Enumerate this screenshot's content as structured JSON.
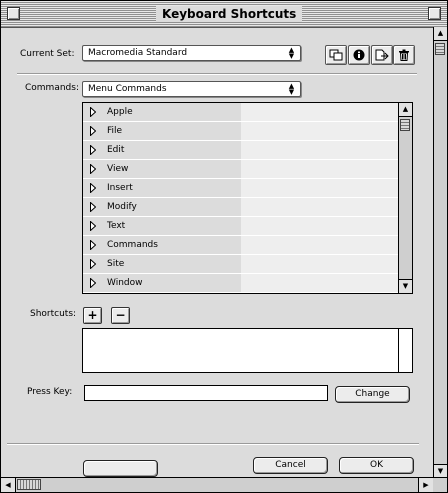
{
  "window": {
    "title": "Keyboard Shortcuts"
  },
  "current_set": {
    "label": "Current Set:",
    "value": "Macromedia Standard"
  },
  "set_buttons": [
    {
      "icon": "duplicate-set-icon"
    },
    {
      "icon": "info-icon"
    },
    {
      "icon": "export-set-icon"
    },
    {
      "icon": "trash-icon"
    }
  ],
  "commands": {
    "label": "Commands:",
    "value": "Menu Commands",
    "items": [
      {
        "name": "Apple"
      },
      {
        "name": "File"
      },
      {
        "name": "Edit"
      },
      {
        "name": "View"
      },
      {
        "name": "Insert"
      },
      {
        "name": "Modify"
      },
      {
        "name": "Text"
      },
      {
        "name": "Commands"
      },
      {
        "name": "Site"
      },
      {
        "name": "Window"
      }
    ]
  },
  "shortcuts": {
    "label": "Shortcuts:",
    "add": "+",
    "remove": "−"
  },
  "press_key": {
    "label": "Press Key:",
    "value": "",
    "change_label": "Change"
  },
  "footer": {
    "cancel_label": "Cancel",
    "ok_label": "OK"
  }
}
